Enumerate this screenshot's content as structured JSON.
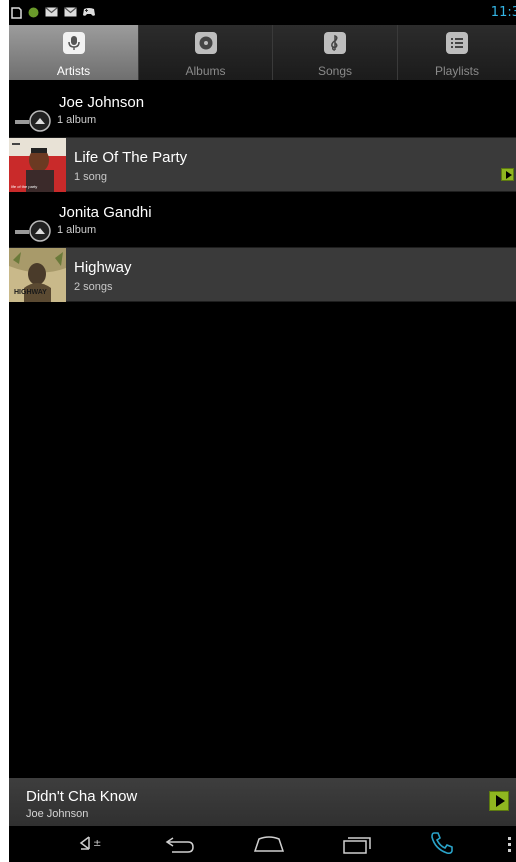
{
  "status_bar": {
    "time": "11:3",
    "icons": [
      "screenshot-icon",
      "green-dot-icon",
      "gmail-icon",
      "gmail-icon",
      "game-controller-icon"
    ]
  },
  "tabs": [
    {
      "label": "Artists",
      "icon": "microphone-icon",
      "active": true
    },
    {
      "label": "Albums",
      "icon": "disc-icon",
      "active": false
    },
    {
      "label": "Songs",
      "icon": "treble-clef-icon",
      "active": false
    },
    {
      "label": "Playlists",
      "icon": "list-icon",
      "active": false
    }
  ],
  "list": {
    "artists": [
      {
        "name": "Joe Johnson",
        "count": "1 album",
        "album": {
          "title": "Life Of The Party",
          "count": "1 song",
          "art_caption": "life of the party"
        }
      },
      {
        "name": "Jonita Gandhi",
        "count": "1 album",
        "album": {
          "title": "Highway",
          "count": "2 songs",
          "art_caption": "HIGHWAY"
        }
      }
    ]
  },
  "now_playing": {
    "title": "Didn't Cha Know",
    "artist": "Joe Johnson"
  },
  "nav_bar": {
    "buttons": [
      "volume-icon",
      "back-icon",
      "home-icon",
      "recent-apps-icon",
      "phone-icon",
      "menu-icon"
    ]
  },
  "colors": {
    "accent_blue": "#33b5e5",
    "play_green": "#8fb620",
    "row_highlight": "#3a3a3a"
  }
}
